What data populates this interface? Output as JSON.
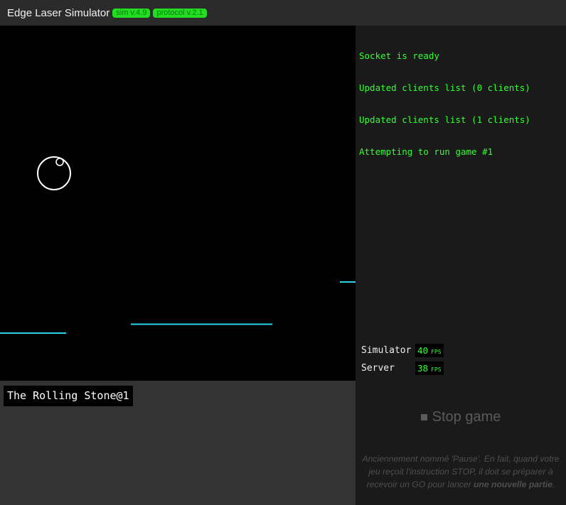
{
  "header": {
    "title": "Edge Laser Simulator",
    "badges": [
      "sim v.4.9",
      "protocol v.2.1"
    ]
  },
  "console": {
    "lines": [
      "Socket is ready",
      "Updated clients list (0 clients)",
      "Updated clients list (1 clients)",
      "Attempting to run game #1"
    ]
  },
  "fps": {
    "simulator": {
      "label": "Simulator",
      "value": "40",
      "unit": "FPS"
    },
    "server": {
      "label": "Server",
      "value": "38",
      "unit": "FPS"
    }
  },
  "player": {
    "name": "The Rolling Stone@1"
  },
  "controls": {
    "stop_label": "Stop game",
    "stop_icon": "stop-icon",
    "description_prefix": "Anciennement nommé 'Pause'. En fait, quand votre jeu reçoit l'instruction STOP, il doit se préparer à recevoir un GO pour lancer ",
    "description_bold": "une nouvelle partie",
    "description_suffix": "."
  },
  "colors": {
    "laser_accent": "#2ad4ea",
    "console_text": "#33ff33",
    "badge_bg": "#22dd22",
    "badge_text": "#0a7a0a"
  }
}
